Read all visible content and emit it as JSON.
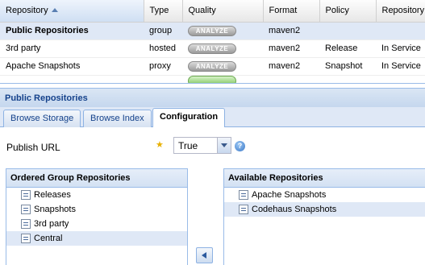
{
  "grid": {
    "columns": [
      "Repository",
      "Type",
      "Quality",
      "Format",
      "Policy",
      "Repository"
    ],
    "rows": [
      {
        "name": "Public Repositories",
        "type": "group",
        "quality": "ANALYZE",
        "format": "maven2",
        "policy": "",
        "status": ""
      },
      {
        "name": "3rd party",
        "type": "hosted",
        "quality": "ANALYZE",
        "format": "maven2",
        "policy": "Release",
        "status": "In Service"
      },
      {
        "name": "Apache Snapshots",
        "type": "proxy",
        "quality": "ANALYZE",
        "format": "maven2",
        "policy": "Snapshot",
        "status": "In Service"
      }
    ]
  },
  "panel": {
    "title": "Public Repositories",
    "tabs": [
      "Browse Storage",
      "Browse Index",
      "Configuration"
    ],
    "active_tab": "Configuration"
  },
  "form": {
    "publish_label": "Publish URL",
    "publish_value": "True"
  },
  "ordered_group": {
    "title": "Ordered Group Repositories",
    "items": [
      "Releases",
      "Snapshots",
      "3rd party",
      "Central"
    ],
    "selected": "Central"
  },
  "available": {
    "title": "Available Repositories",
    "items": [
      "Apache Snapshots",
      "Codehaus Snapshots"
    ],
    "selected": "Codehaus Snapshots"
  },
  "icons": {
    "sort": "sort-ascending-icon",
    "help": "help-icon",
    "repo": "repository-icon",
    "move": "arrow-left-icon"
  },
  "colors": {
    "selection": "#dfe8f6",
    "header_text": "#15428b",
    "required": "#e8b000"
  }
}
